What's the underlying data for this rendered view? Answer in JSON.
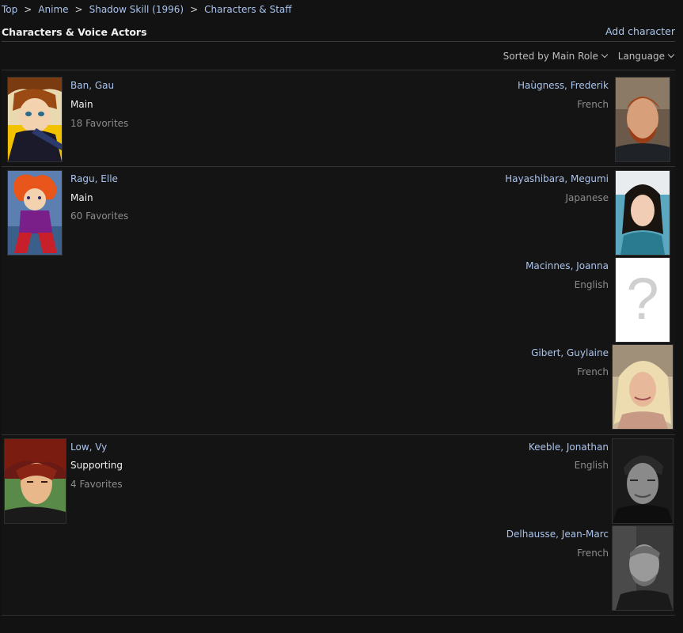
{
  "breadcrumb": {
    "items": [
      "Top",
      "Anime",
      "Shadow Skill (1996)",
      "Characters & Staff"
    ],
    "separator": ">"
  },
  "header": {
    "title": "Characters & Voice Actors",
    "add_label": "Add character"
  },
  "controls": {
    "sort_label": "Sorted by Main Role",
    "language_label": "Language"
  },
  "characters": [
    {
      "name": "Ban, Gau",
      "role": "Main",
      "favorites": "18 Favorites",
      "voice_actors": [
        {
          "name": "Haùgness, Frederik",
          "language": "French"
        }
      ]
    },
    {
      "name": "Ragu, Elle",
      "role": "Main",
      "favorites": "60 Favorites",
      "voice_actors": [
        {
          "name": "Hayashibara, Megumi",
          "language": "Japanese"
        },
        {
          "name": "Macinnes, Joanna",
          "language": "English"
        },
        {
          "name": "Gibert, Guylaine",
          "language": "French"
        }
      ]
    },
    {
      "name": "Low, Vy",
      "role": "Supporting",
      "favorites": "4 Favorites",
      "voice_actors": [
        {
          "name": "Keeble, Jonathan",
          "language": "English"
        },
        {
          "name": "Delhausse, Jean-Marc",
          "language": "French"
        }
      ]
    }
  ],
  "placeholder_glyph": "?",
  "colors": {
    "background": "#121212",
    "link": "#abc4ed",
    "muted": "#8c8c8c"
  }
}
